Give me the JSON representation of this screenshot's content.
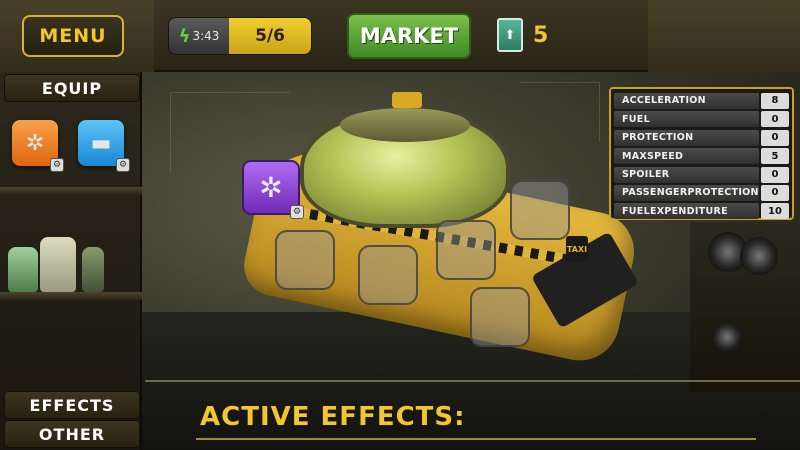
{
  "topbar": {
    "menu_label": "MENU",
    "energy_time": "3:43",
    "energy_count": "5/6",
    "market_label": "MARKET",
    "money_value": "5"
  },
  "leftnav": {
    "equip_tab": "EQUIP",
    "effects_tab": "EFFECTS",
    "other_tab": "OTHER",
    "items": [
      {
        "icon": "gear-icon",
        "color": "#f07a1a"
      },
      {
        "icon": "gun-icon",
        "color": "#2ba2ea"
      }
    ]
  },
  "stats": [
    {
      "label": "ACCELERATION",
      "value": "8"
    },
    {
      "label": "FUEL",
      "value": "0"
    },
    {
      "label": "PROTECTION",
      "value": "0"
    },
    {
      "label": "MAXSPEED",
      "value": "5"
    },
    {
      "label": "SPOILER",
      "value": "0"
    },
    {
      "label": "PASSENGERPROTECTION",
      "value": "0"
    },
    {
      "label": "FUELEXPENDITURE",
      "value": "10"
    }
  ],
  "vehicle": {
    "sign": "TAXI"
  },
  "effects": {
    "title": "ACTIVE EFFECTS:"
  },
  "colors": {
    "accent_gold": "#f2c531",
    "market_green": "#5aa834",
    "equipped_purple": "#9a4fe0"
  }
}
